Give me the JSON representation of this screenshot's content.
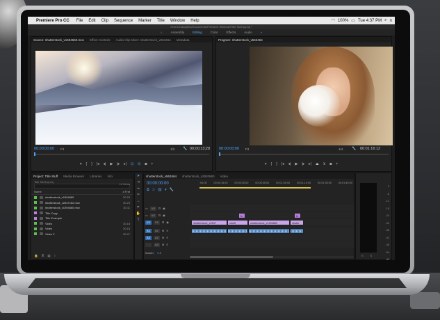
{
  "os_menubar": {
    "app_name": "Premiere Pro CC",
    "menus": [
      "File",
      "Edit",
      "Clip",
      "Sequence",
      "Marker",
      "Title",
      "Window",
      "Help"
    ],
    "battery": "100%",
    "clock": "Tue 4:37 PM"
  },
  "path": "/Users/Caseyflint/Documents/Premiere Shellode/Title Stuff.prproj *",
  "workspaces": [
    "Assembly",
    "Editing",
    "Color",
    "Effects",
    "Audio"
  ],
  "active_workspace": "Editing",
  "source_panel": {
    "tabs": [
      "Source: shutterstock_v1594660.mov",
      "Effect Controls",
      "Audio Clip Mixer: shutterstock_v563464",
      "Metadata"
    ],
    "timecode": "00;00;00;00",
    "fit": "Fit",
    "fraction": "1/2",
    "duration": "00;00;13;28"
  },
  "program_panel": {
    "tabs": [
      "Program: shutterstock_v563464"
    ],
    "timecode": "00:00:00:00",
    "fit": "Fit",
    "fraction": "1/4",
    "duration": "00:01:16:12"
  },
  "project_panel": {
    "tabs": [
      "Project: Title Stuff",
      "Media Browser",
      "Libraries",
      "Info"
    ],
    "file": "Title Stuff.prproj",
    "item_count": "12 Items",
    "col_name": "Name",
    "col_rate": "a Frat",
    "items": [
      {
        "name": "shutterstock_v1594660",
        "dur": "30.23",
        "color": "#5fbf4f"
      },
      {
        "name": "shutterstock_v2647162.mov",
        "dur": "30.23",
        "color": "#5fbf4f"
      },
      {
        "name": "shutterstock_v1594660.mov",
        "dur": "30.11",
        "color": "#5fbf4f"
      },
      {
        "name": "Title Copy",
        "dur": "",
        "color": "#c07fe0"
      },
      {
        "name": "Title Example",
        "dur": "",
        "color": "#c07fe0"
      },
      {
        "name": "Video",
        "dur": "30.18",
        "color": "#5fbf4f"
      },
      {
        "name": "Video",
        "dur": "30.18",
        "color": "#5fbf4f"
      },
      {
        "name": "Video 2",
        "dur": "30.47",
        "color": "#5fbf4f"
      }
    ]
  },
  "timeline": {
    "tabs": [
      "shutterstock_v563464",
      "shutterstock_v2820660",
      "Video"
    ],
    "timecode": "00:00:00:00",
    "ruler": [
      ":00:00",
      "00:00:15:00",
      "00:00:30:00",
      "00:00:45:00",
      "00:01:00:00",
      "00:01:15:00",
      "00:01:30:00",
      "00:01:45:00"
    ],
    "video_tracks": [
      "V3",
      "V2",
      "V1"
    ],
    "audio_tracks": [
      "A1",
      "A2",
      "A3"
    ],
    "v1_clips": [
      "shutterstock_v2647",
      "shuttl",
      "shutterstock_v1594660",
      "shutte"
    ],
    "v2_clip_label": "fx",
    "master_label": "Master",
    "master_value": "0.0"
  },
  "meters": {
    "scale": [
      "0",
      "-6",
      "-12",
      "-18",
      "-24",
      "-30",
      "-36",
      "-42",
      "-48",
      "-54",
      "dB"
    ],
    "channels": [
      "S",
      "S"
    ]
  }
}
